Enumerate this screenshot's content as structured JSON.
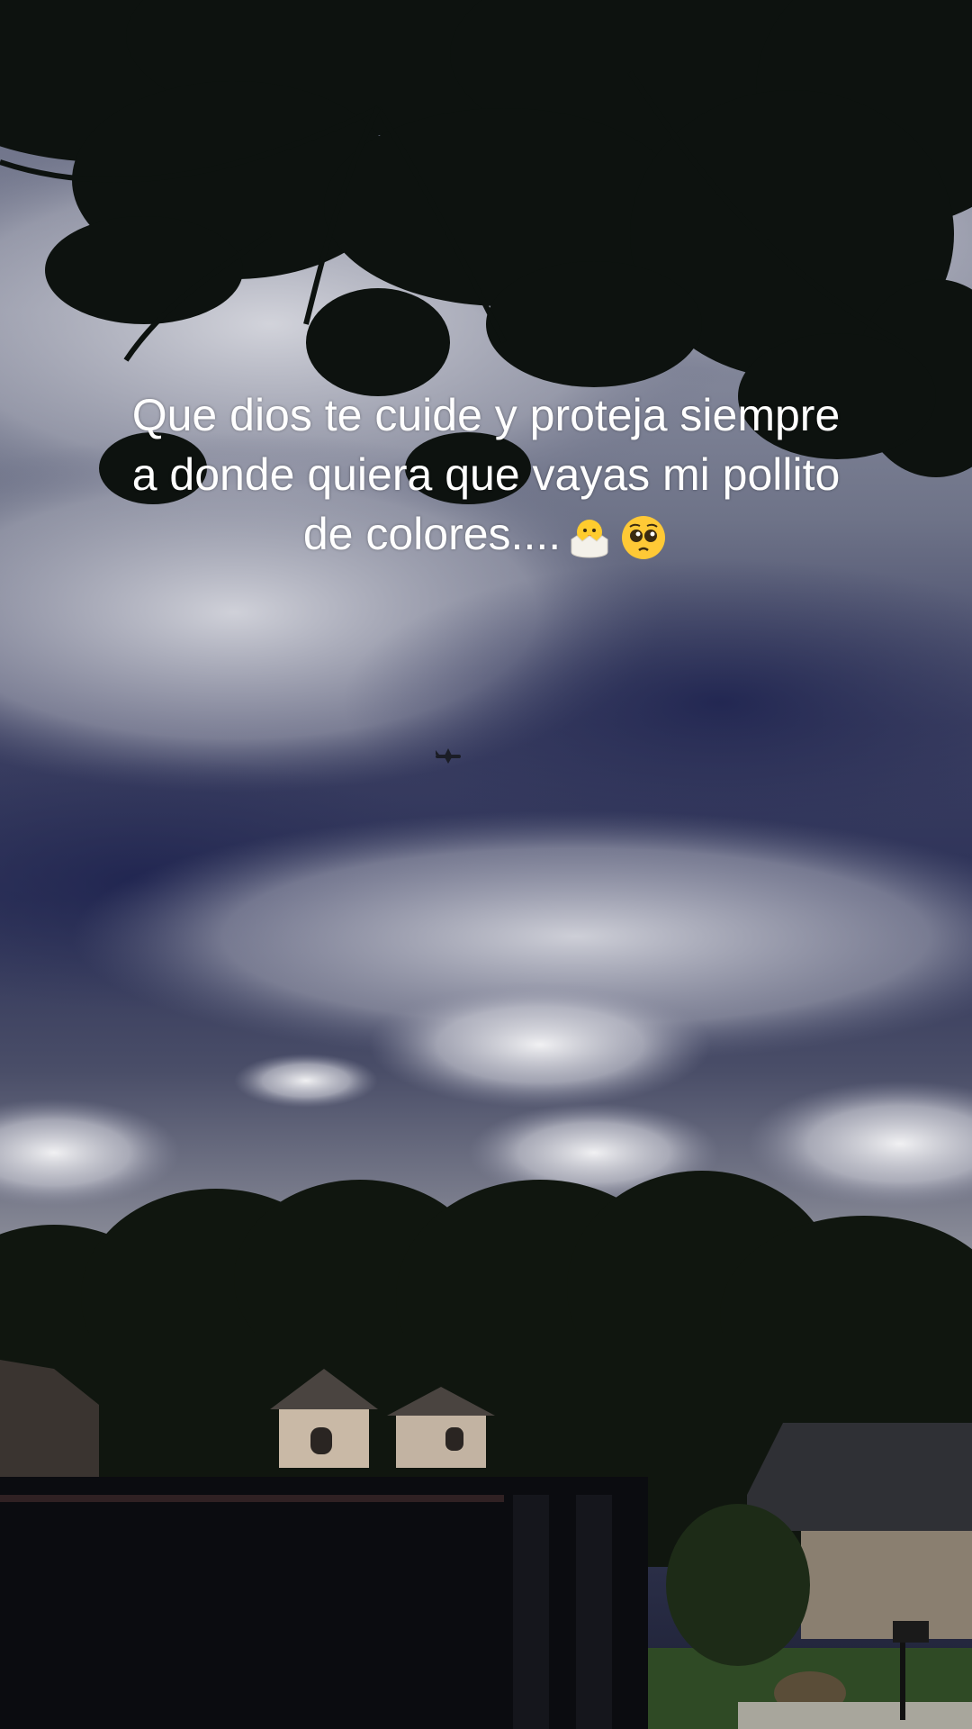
{
  "caption": {
    "line1": "Que dios te cuide y proteja siempre",
    "line2": "a donde quiera que vayas mi pollito",
    "line3": "de colores...."
  },
  "emojis": [
    "hatching-chick-icon",
    "pleading-face-icon"
  ],
  "colors": {
    "text": "#ffffff",
    "sky_dark": "#2d3258",
    "cloud_light": "#c9cbd3",
    "foliage": "#0f1410"
  }
}
